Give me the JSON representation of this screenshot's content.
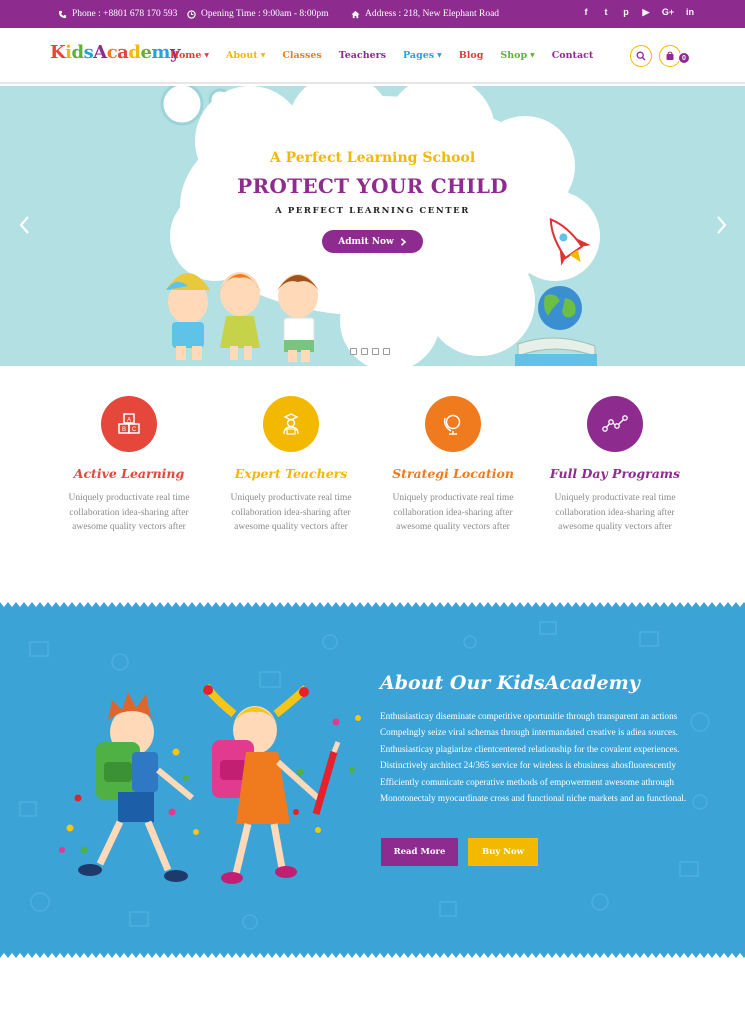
{
  "topbar": {
    "phone": "Phone : +8801 678 170 593",
    "hours": "Opening Time : 9:00am - 8:00pm",
    "address": "Address : 218, New Elephant Road",
    "social_icons": [
      "facebook-icon",
      "twitter-icon",
      "pinterest-icon",
      "youtube-icon",
      "google-plus-icon",
      "linkedin-icon"
    ],
    "social_glyphs": [
      "f",
      "t",
      "p",
      "▶",
      "G+",
      "in"
    ]
  },
  "header": {
    "logo": "KidsAcademy",
    "nav": [
      {
        "label": "Home",
        "color": "#e23c3c"
      },
      {
        "label": "About",
        "color": "#f3b800"
      },
      {
        "label": "Classes",
        "color": "#f07b1e"
      },
      {
        "label": "Teachers",
        "color": "#8e2b8e"
      },
      {
        "label": "Pages",
        "color": "#2a9fd8"
      },
      {
        "label": "Blog",
        "color": "#e23c3c"
      },
      {
        "label": "Shop",
        "color": "#5fb332"
      },
      {
        "label": "Contact",
        "color": "#8e2b8e"
      }
    ],
    "cart_count": "0"
  },
  "hero": {
    "kicker": "A Perfect Learning School",
    "headline": "PROTECT YOUR CHILD",
    "sub": "A PERFECT LEARNING CENTER",
    "button": "Admit Now"
  },
  "features": [
    {
      "title": "Active Learning",
      "color": "#e5473b",
      "icon": "abc-blocks-icon",
      "desc": "Uniquely productivate real time collaboration idea-sharing after awesome quality vectors after"
    },
    {
      "title": "Expert Teachers",
      "color": "#f3b800",
      "icon": "teacher-icon",
      "desc": "Uniquely productivate real time collaboration idea-sharing after awesome quality vectors after"
    },
    {
      "title": "Strategi Location",
      "color": "#f07b1e",
      "icon": "globe-icon",
      "desc": "Uniquely productivate real time collaboration idea-sharing after awesome quality vectors after"
    },
    {
      "title": "Full Day Programs",
      "color": "#8e2b8e",
      "icon": "chart-line-icon",
      "desc": "Uniquely productivate real time collaboration idea-sharing after awesome quality vectors after"
    }
  ],
  "about": {
    "title": "About Our KidsAcademy",
    "body": "Enthusiasticay diseminate competitive oportunitie through transparent an actions Compelngly seize viral schemas through intermandated creative is adiea sources. Enthusiasticay plagiarize clientcentered relationship for the covalent experiences. Distinctively architect 24/365 service for wireless is ebusiness ahosfluorescently Efficiently comunicate coperative methods of empowerment awesome athrough Monotonectaly myocardinate cross and functional niche markets and an functional.",
    "read_more": "Read More",
    "buy_now": "Buy Now"
  },
  "colors": {
    "purple": "#8e2b8e",
    "yellow": "#f3b800",
    "red": "#e5473b",
    "orange": "#f07b1e",
    "blue": "#3ba3d6",
    "hero_bg": "#b3e0e2"
  }
}
